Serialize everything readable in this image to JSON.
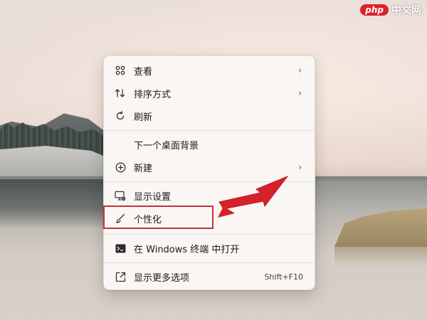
{
  "watermark": {
    "logo": "php",
    "text": "中文网"
  },
  "menu": {
    "items": [
      {
        "label": "查看",
        "icon": "grid-icon",
        "has_submenu": true
      },
      {
        "label": "排序方式",
        "icon": "sort-icon",
        "has_submenu": true
      },
      {
        "label": "刷新",
        "icon": "refresh-icon",
        "has_submenu": false
      },
      {
        "label": "下一个桌面背景",
        "icon": "",
        "has_submenu": false
      },
      {
        "label": "新建",
        "icon": "add-circle-icon",
        "has_submenu": true
      },
      {
        "label": "显示设置",
        "icon": "display-settings-icon",
        "has_submenu": false
      },
      {
        "label": "个性化",
        "icon": "brush-icon",
        "has_submenu": false,
        "highlighted": true
      },
      {
        "label": "在 Windows 终端 中打开",
        "icon": "terminal-icon",
        "has_submenu": false
      },
      {
        "label": "显示更多选项",
        "icon": "more-options-icon",
        "has_submenu": false,
        "shortcut": "Shift+F10"
      }
    ],
    "chevron": "›"
  },
  "colors": {
    "highlight_border": "#c4323a",
    "arrow": "#d4212b",
    "menu_bg": "#f9f6f4"
  }
}
